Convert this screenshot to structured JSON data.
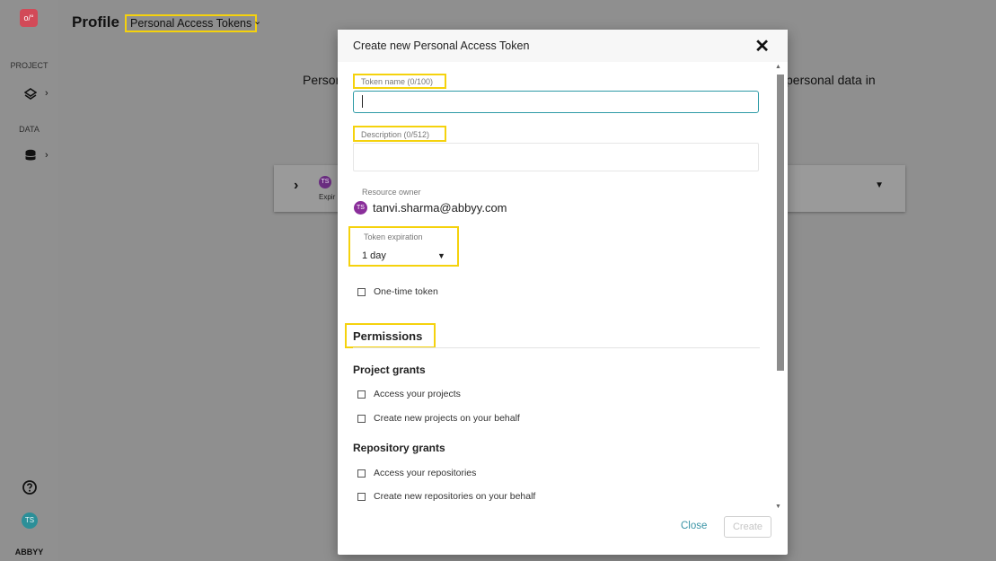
{
  "sidebar": {
    "logo": "o/°",
    "sections": [
      {
        "label": "PROJECT",
        "icon": "layers-icon"
      },
      {
        "label": "DATA",
        "icon": "database-icon"
      }
    ],
    "chevron": "›",
    "help_icon": "help-circle-icon",
    "avatar_initials": "TS",
    "brand": "ABBYY"
  },
  "topbar": {
    "title": "Profile",
    "breadcrumb": "Personal Access Tokens",
    "breadcrumb_chevron": "⌄"
  },
  "background": {
    "intro_left": "Persor",
    "intro_right": "personal data in",
    "card": {
      "chevron": "›",
      "avatar_initials": "TS",
      "sub": "Expir",
      "caret": "▼"
    }
  },
  "modal": {
    "title": "Create new Personal Access Token",
    "close_glyph": "✕",
    "token_name": {
      "label": "Token name (0/100)",
      "value": ""
    },
    "description": {
      "label": "Description (0/512)",
      "value": ""
    },
    "resource_owner": {
      "label": "Resource owner",
      "avatar_initials": "TS",
      "email": "tanvi.sharma@abbyy.com"
    },
    "token_expiration": {
      "label": "Token expiration",
      "value": "1 day",
      "caret": "▼"
    },
    "one_time_token": {
      "label": "One-time token",
      "checked": false
    },
    "permissions_title": "Permissions",
    "project_grants": {
      "title": "Project grants",
      "items": [
        {
          "label": "Access your projects",
          "checked": false
        },
        {
          "label": "Create new projects on your behalf",
          "checked": false
        }
      ]
    },
    "repository_grants": {
      "title": "Repository grants",
      "items": [
        {
          "label": "Access your repositories",
          "checked": false
        },
        {
          "label": "Create new repositories on your behalf",
          "checked": false
        }
      ]
    },
    "footer": {
      "close_label": "Close",
      "create_label": "Create"
    }
  },
  "colors": {
    "accent": "#2d9aa6",
    "highlight": "#f5d20d",
    "avatar": "#8a2e9a",
    "logo": "#d24a58",
    "overlay": "#8f8f8f"
  }
}
